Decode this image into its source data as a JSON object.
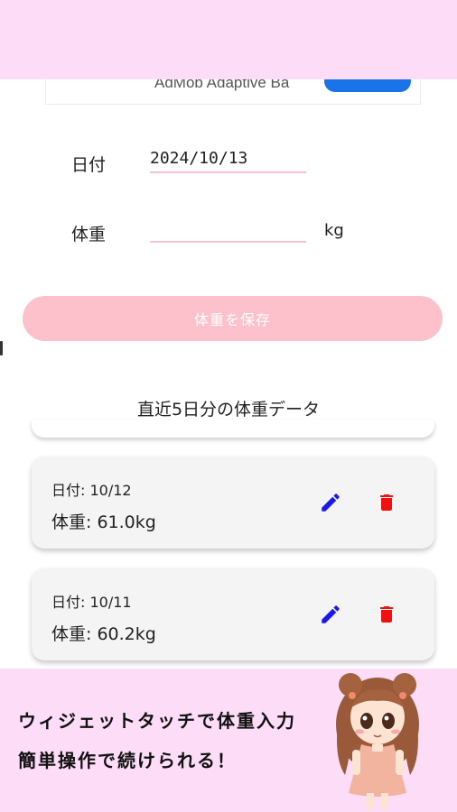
{
  "ad": {
    "text": "AdMob Adaptive Ba"
  },
  "form": {
    "date_label": "日付",
    "date_value": "2024/10/13",
    "weight_label": "体重",
    "weight_value": "",
    "weight_unit": "kg",
    "save_label": "体重を保存"
  },
  "list": {
    "title": "直近5日分の体重データ",
    "entries": [
      {
        "date": "日付: 10/12",
        "weight": "体重: 61.0kg"
      },
      {
        "date": "日付: 10/11",
        "weight": "体重: 60.2kg"
      }
    ]
  },
  "promo": {
    "line1": "ウィジェットタッチで体重入力",
    "line2": "簡単操作で続けられる！"
  },
  "colors": {
    "banner_bg": "#fcdcf6",
    "accent_pink": "#fcc1cb",
    "edit_icon": "#1a1ae6",
    "delete_icon": "#ee1111"
  },
  "icons": [
    "edit-icon",
    "delete-icon",
    "character-illustration"
  ]
}
